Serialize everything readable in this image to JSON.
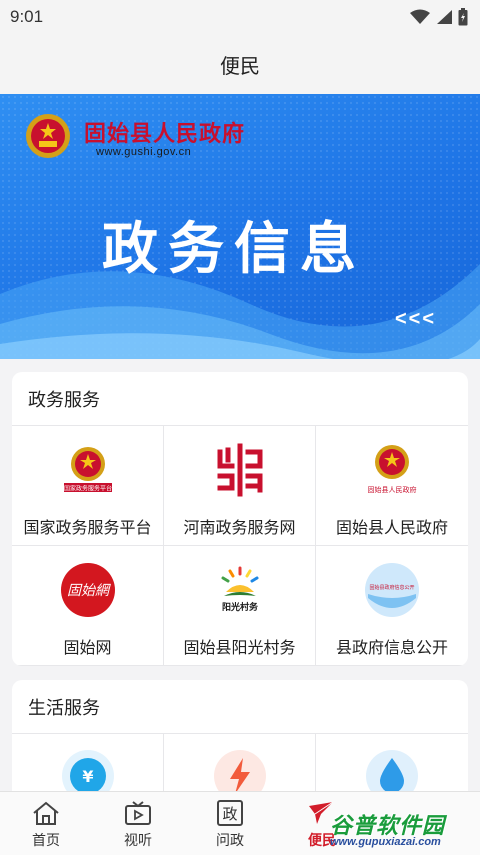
{
  "status_bar": {
    "time": "9:01",
    "icons": [
      "wifi-icon",
      "cellular-icon",
      "battery-icon"
    ]
  },
  "header": {
    "title": "便民"
  },
  "banner": {
    "org_name": "固始县人民政府",
    "url": "www.gushi.gov.cn",
    "title": "政务信息",
    "arrows": "<<<",
    "colors": {
      "background": "#1e74e6",
      "org_text": "#c8102e"
    }
  },
  "gov_services": {
    "title": "政务服务",
    "items": [
      {
        "label": "国家政务服务平台",
        "icon": "national-emblem-icon",
        "icon_text": "国家政务服务平台"
      },
      {
        "label": "河南政务服务网",
        "icon": "henan-gov-service-logo-icon"
      },
      {
        "label": "固始县人民政府",
        "icon": "county-emblem-icon",
        "icon_text": "固始县人民政府"
      },
      {
        "label": "固始网",
        "icon": "gushi-net-logo-icon",
        "icon_text": "固始網"
      },
      {
        "label": "固始县阳光村务",
        "icon": "sunshine-village-logo-icon",
        "icon_text": "阳光村务"
      },
      {
        "label": "县政府信息公开",
        "icon": "gov-info-public-icon",
        "icon_text": "固始县政府信息公开"
      }
    ]
  },
  "life_services": {
    "title": "生活服务",
    "items": [
      {
        "icon": "money-bag-icon",
        "color": "#20a6e8"
      },
      {
        "icon": "lightning-icon",
        "color": "#f25b3c"
      },
      {
        "icon": "water-drop-icon",
        "color": "#2e9be8"
      }
    ]
  },
  "tab_bar": {
    "tabs": [
      {
        "label": "首页",
        "icon": "home-icon"
      },
      {
        "label": "视听",
        "icon": "tv-play-icon"
      },
      {
        "label": "问政",
        "icon": "wenzheng-icon",
        "icon_text": "政"
      },
      {
        "label": "便民",
        "icon": "bianmin-icon",
        "active": true
      }
    ],
    "active_color": "#d21d2a"
  },
  "watermark": {
    "text": "谷普软件园",
    "url": "www.gupuxiazai.com"
  }
}
